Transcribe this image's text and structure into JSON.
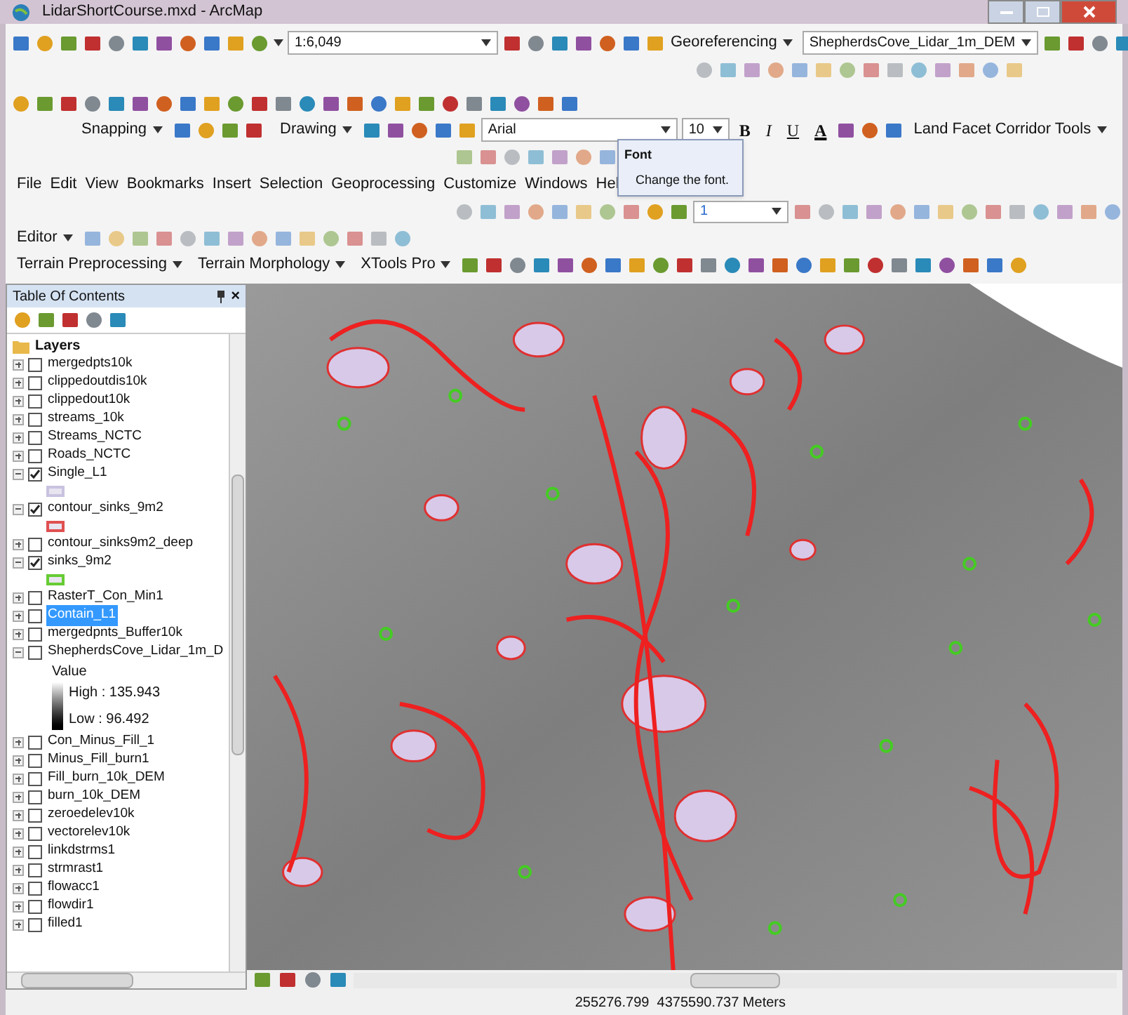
{
  "window": {
    "title": "LidarShortCourse.mxd - ArcMap"
  },
  "standard_toolbar": {
    "scale": "1:6,049"
  },
  "georeferencing_toolbar": {
    "menu": "Georeferencing",
    "layer": "ShepherdsCove_Lidar_1m_DEM"
  },
  "snapping_toolbar": {
    "menu": "Snapping"
  },
  "draw_toolbar": {
    "menu": "Drawing",
    "font": "Arial",
    "size": "10",
    "bold": "B",
    "italic": "I",
    "underline": "U",
    "font_color": "A"
  },
  "land_facet_toolbar": {
    "menu": "Land Facet Corridor Tools"
  },
  "menu_bar": [
    "File",
    "Edit",
    "View",
    "Bookmarks",
    "Insert",
    "Selection",
    "Geoprocessing",
    "Customize",
    "Windows",
    "Hel"
  ],
  "tooltip": {
    "title": "Font",
    "text": "Change the font."
  },
  "effects_toolbar": {
    "value": "1"
  },
  "editor_toolbar": {
    "menu": "Editor"
  },
  "terrain_toolbar": {
    "menus": [
      "Terrain Preprocessing",
      "Terrain Morphology"
    ]
  },
  "xtools_toolbar": {
    "menu": "XTools Pro"
  },
  "toc": {
    "title": "Table Of Contents",
    "close": "×",
    "group": "Layers",
    "layers": [
      {
        "name": "mergedpts10k",
        "checked": false,
        "expanded": false,
        "selected": false
      },
      {
        "name": "clippedoutdis10k",
        "checked": false,
        "expanded": false,
        "selected": false
      },
      {
        "name": "clippedout10k",
        "checked": false,
        "expanded": false,
        "selected": false
      },
      {
        "name": "streams_10k",
        "checked": false,
        "expanded": false,
        "selected": false
      },
      {
        "name": "Streams_NCTC",
        "checked": false,
        "expanded": false,
        "selected": false
      },
      {
        "name": "Roads_NCTC",
        "checked": false,
        "expanded": false,
        "selected": false
      },
      {
        "name": "Single_L1",
        "checked": true,
        "expanded": true,
        "selected": false,
        "legend": {
          "kind": "swatch",
          "color": "#c9c3e0"
        }
      },
      {
        "name": "contour_sinks_9m2",
        "checked": true,
        "expanded": true,
        "selected": false,
        "legend": {
          "kind": "swatch",
          "color": "#e05050"
        }
      },
      {
        "name": "contour_sinks9m2_deep",
        "checked": false,
        "expanded": false,
        "selected": false
      },
      {
        "name": "sinks_9m2",
        "checked": true,
        "expanded": true,
        "selected": false,
        "legend": {
          "kind": "swatch",
          "color": "#66cc33"
        }
      },
      {
        "name": "RasterT_Con_Min1",
        "checked": false,
        "expanded": false,
        "selected": false
      },
      {
        "name": "Contain_L1",
        "checked": false,
        "expanded": false,
        "selected": true
      },
      {
        "name": "mergedpnts_Buffer10k",
        "checked": false,
        "expanded": false,
        "selected": false
      },
      {
        "name": "ShepherdsCove_Lidar_1m_D",
        "checked": false,
        "expanded": true,
        "selected": false,
        "legend": {
          "kind": "ramp",
          "title": "Value",
          "high": "High : 135.943",
          "low": "Low : 96.492"
        }
      },
      {
        "name": "Con_Minus_Fill_1",
        "checked": false,
        "expanded": false,
        "selected": false
      },
      {
        "name": "Minus_Fill_burn1",
        "checked": false,
        "expanded": false,
        "selected": false
      },
      {
        "name": "Fill_burn_10k_DEM",
        "checked": false,
        "expanded": false,
        "selected": false
      },
      {
        "name": "burn_10k_DEM",
        "checked": false,
        "expanded": false,
        "selected": false
      },
      {
        "name": "zeroedelev10k",
        "checked": false,
        "expanded": false,
        "selected": false
      },
      {
        "name": "vectorelev10k",
        "checked": false,
        "expanded": false,
        "selected": false
      },
      {
        "name": "linkdstrms1",
        "checked": false,
        "expanded": false,
        "selected": false
      },
      {
        "name": "strmrast1",
        "checked": false,
        "expanded": false,
        "selected": false
      },
      {
        "name": "flowacc1",
        "checked": false,
        "expanded": false,
        "selected": false
      },
      {
        "name": "flowdir1",
        "checked": false,
        "expanded": false,
        "selected": false
      },
      {
        "name": "filled1",
        "checked": false,
        "expanded": false,
        "selected": false
      }
    ]
  },
  "status_bar": {
    "coordinates": "255276.799  4375590.737 Meters"
  }
}
